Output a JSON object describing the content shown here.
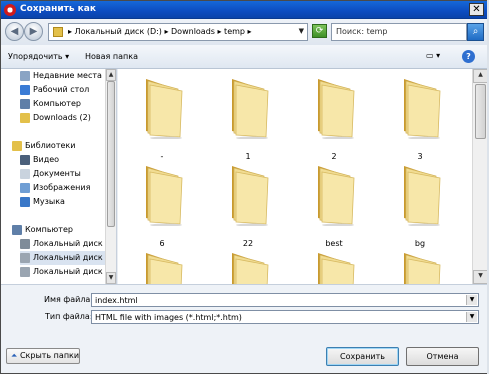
{
  "window": {
    "title": "Сохранить как"
  },
  "nav": {
    "address_segments": "▸ Локальный диск (D:) ▸ Downloads ▸ temp ▸",
    "search_placeholder": "Поиск: temp"
  },
  "toolbar": {
    "organize": "Упорядочить ▾",
    "new_folder": "Новая папка"
  },
  "sidebar": {
    "items": [
      {
        "label": "Недавние места",
        "icon": "recent-places-icon",
        "color": "#8aa4c4"
      },
      {
        "label": "Рабочий стол",
        "icon": "desktop-icon",
        "color": "#3a7bd5"
      },
      {
        "label": "Компьютер",
        "icon": "computer-icon",
        "color": "#5f7fa8"
      },
      {
        "label": "Downloads (2)",
        "icon": "folder-icon",
        "color": "#e3c04a"
      },
      {
        "label": "Библиотеки",
        "icon": "libraries-icon",
        "color": "#e3c04a"
      },
      {
        "label": "Видео",
        "icon": "video-icon",
        "color": "#4a5f7a"
      },
      {
        "label": "Документы",
        "icon": "documents-icon",
        "color": "#c9d3de"
      },
      {
        "label": "Изображения",
        "icon": "pictures-icon",
        "color": "#6f9ed4"
      },
      {
        "label": "Музыка",
        "icon": "music-icon",
        "color": "#3a78c8"
      },
      {
        "label": "Компьютер",
        "icon": "computer-icon",
        "color": "#5f7fa8"
      },
      {
        "label": "Локальный диск (",
        "icon": "drive-icon",
        "color": "#7f8c99"
      },
      {
        "label": "Локальный диск (",
        "icon": "drive-icon",
        "color": "#9aa5b1"
      },
      {
        "label": "Локальный диск (",
        "icon": "drive-icon",
        "color": "#9aa5b1"
      }
    ]
  },
  "files": [
    {
      "name": "-"
    },
    {
      "name": "1"
    },
    {
      "name": "2"
    },
    {
      "name": "3"
    },
    {
      "name": "6"
    },
    {
      "name": "22"
    },
    {
      "name": "best"
    },
    {
      "name": "bg"
    },
    {
      "name": ""
    },
    {
      "name": ""
    },
    {
      "name": ""
    },
    {
      "name": ""
    }
  ],
  "form": {
    "filename_label": "Имя файла:",
    "filename_value": "index.html",
    "filetype_label": "Тип файла:",
    "filetype_value": "HTML file with images (*.html;*.htm)"
  },
  "buttons": {
    "hide_folders": "Скрыть папки",
    "save": "Сохранить",
    "cancel": "Отмена"
  }
}
